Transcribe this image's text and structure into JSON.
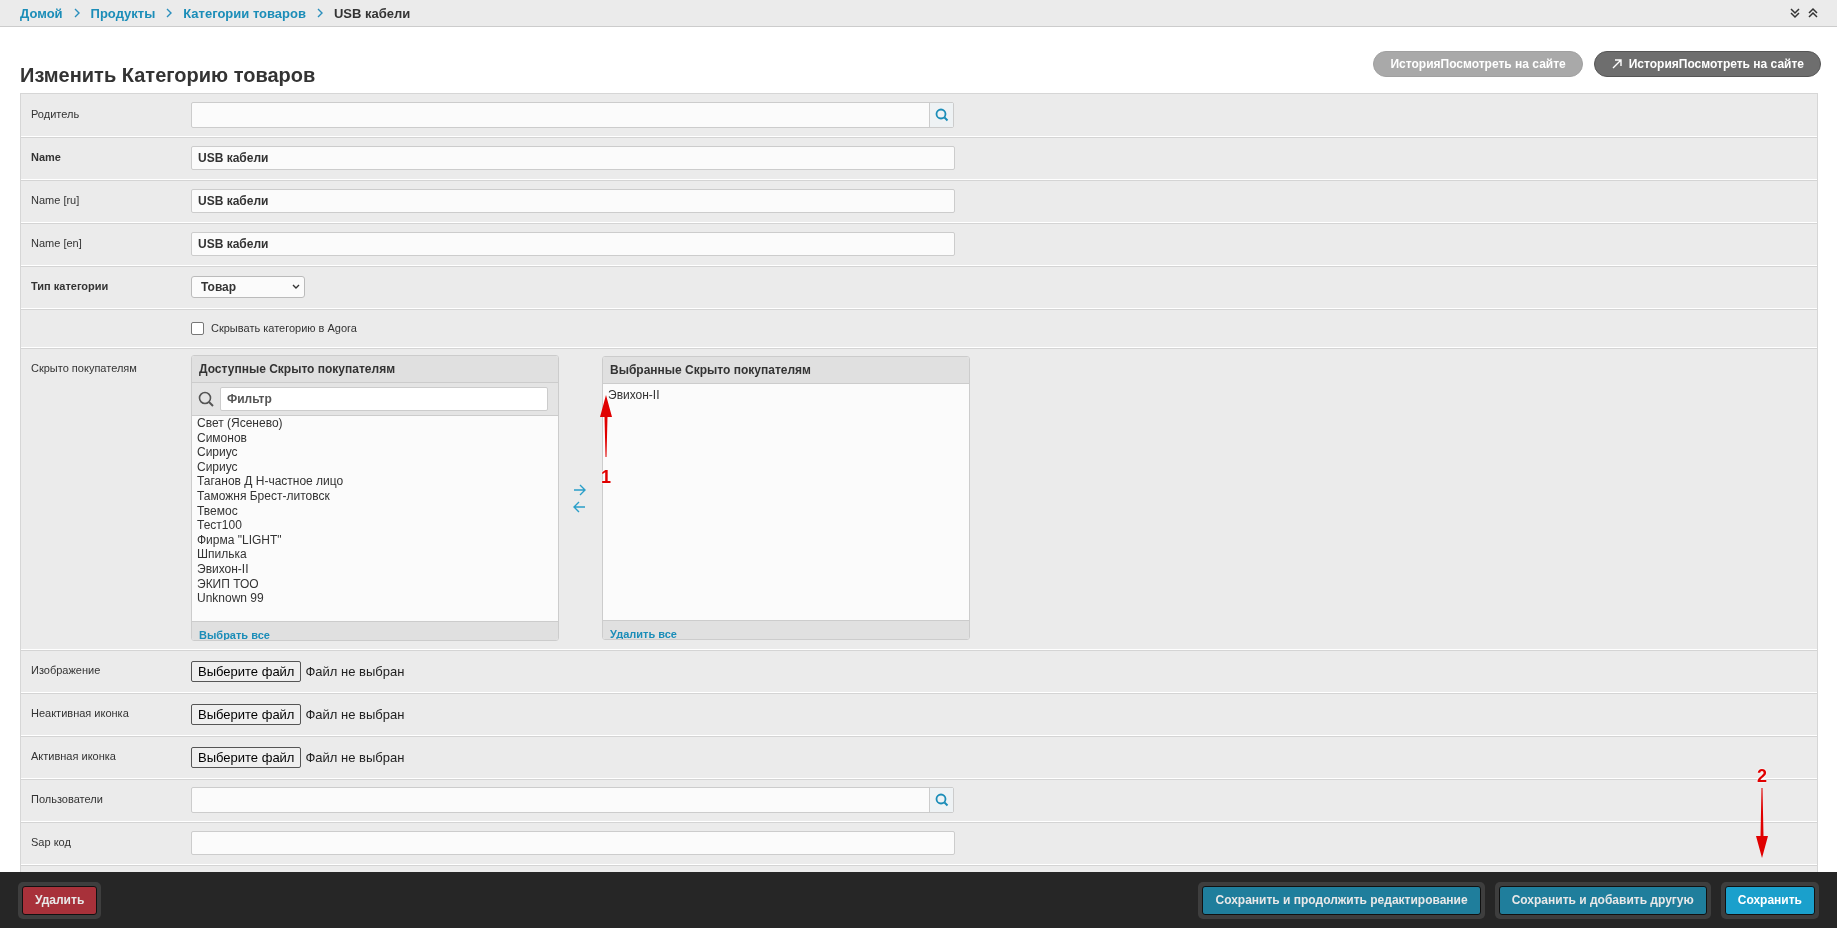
{
  "breadcrumb": [
    {
      "label": "Домой",
      "link": true
    },
    {
      "label": "Продукты",
      "link": true
    },
    {
      "label": "Категории товаров",
      "link": true
    },
    {
      "label": "USB кабели",
      "link": false
    }
  ],
  "page_title": "Изменить Категорию товаров",
  "header_buttons": [
    {
      "label": "ИсторияПосмотреть на сайте",
      "disabled": true,
      "icon": false
    },
    {
      "label": "ИсторияПосмотреть на сайте",
      "disabled": false,
      "icon": true
    }
  ],
  "form_rows": [
    {
      "kind": "lookup",
      "label": "Родитель",
      "required": false,
      "value": ""
    },
    {
      "kind": "text",
      "label": "Name",
      "required": true,
      "value": "USB кабели"
    },
    {
      "kind": "text",
      "label": "Name [ru]",
      "required": false,
      "value": "USB кабели"
    },
    {
      "kind": "text",
      "label": "Name [en]",
      "required": false,
      "value": "USB кабели"
    },
    {
      "kind": "select",
      "label": "Тип категории",
      "required": true,
      "value": "Товар"
    },
    {
      "kind": "checkbox",
      "text": "Скрывать категорию в Agora",
      "checked": false
    },
    {
      "kind": "dual-list",
      "label": "Скрыто покупателям",
      "required": false,
      "available_title": "Доступные Скрыто покупателям",
      "filter_placeholder": "Фильтр",
      "available": [
        "Свет (Ясенево)",
        "Симонов",
        "Сириус",
        "Сириус",
        "Таганов Д Н-частное лицо",
        "Таможня Брест-литовск",
        "Твемос",
        "Тест100",
        "Фирма \"LIGHT\"",
        "Шпилька",
        "Эвихон-II",
        "ЭКИП ТОО",
        "Unknown 99"
      ],
      "select_all": "Выбрать все",
      "chosen_title": "Выбранные Скрыто покупателям",
      "chosen": [
        "Эвихон-II"
      ],
      "remove_all": "Удалить все"
    },
    {
      "kind": "file",
      "label": "Изображение",
      "required": false,
      "button": "Выберите файл",
      "status": "Файл не выбран"
    },
    {
      "kind": "file",
      "label": "Неактивная иконка",
      "required": false,
      "button": "Выберите файл",
      "status": "Файл не выбран"
    },
    {
      "kind": "file",
      "label": "Активная иконка",
      "required": false,
      "button": "Выберите файл",
      "status": "Файл не выбран"
    },
    {
      "kind": "lookup",
      "label": "Пользователи",
      "required": false,
      "value": ""
    },
    {
      "kind": "text",
      "label": "Sap код",
      "required": false,
      "value": ""
    }
  ],
  "footer_buttons": [
    {
      "label": "Удалить",
      "kind": "danger",
      "default": false
    },
    {
      "label": "Сохранить и продолжить редактирование",
      "kind": "save",
      "default": false
    },
    {
      "label": "Сохранить и добавить другую",
      "kind": "save",
      "default": false
    },
    {
      "label": "Сохранить",
      "kind": "save",
      "default": true
    }
  ],
  "annotations": [
    {
      "label": "1",
      "kind": "arrow-up"
    },
    {
      "label": "2",
      "kind": "arrow-down"
    }
  ]
}
